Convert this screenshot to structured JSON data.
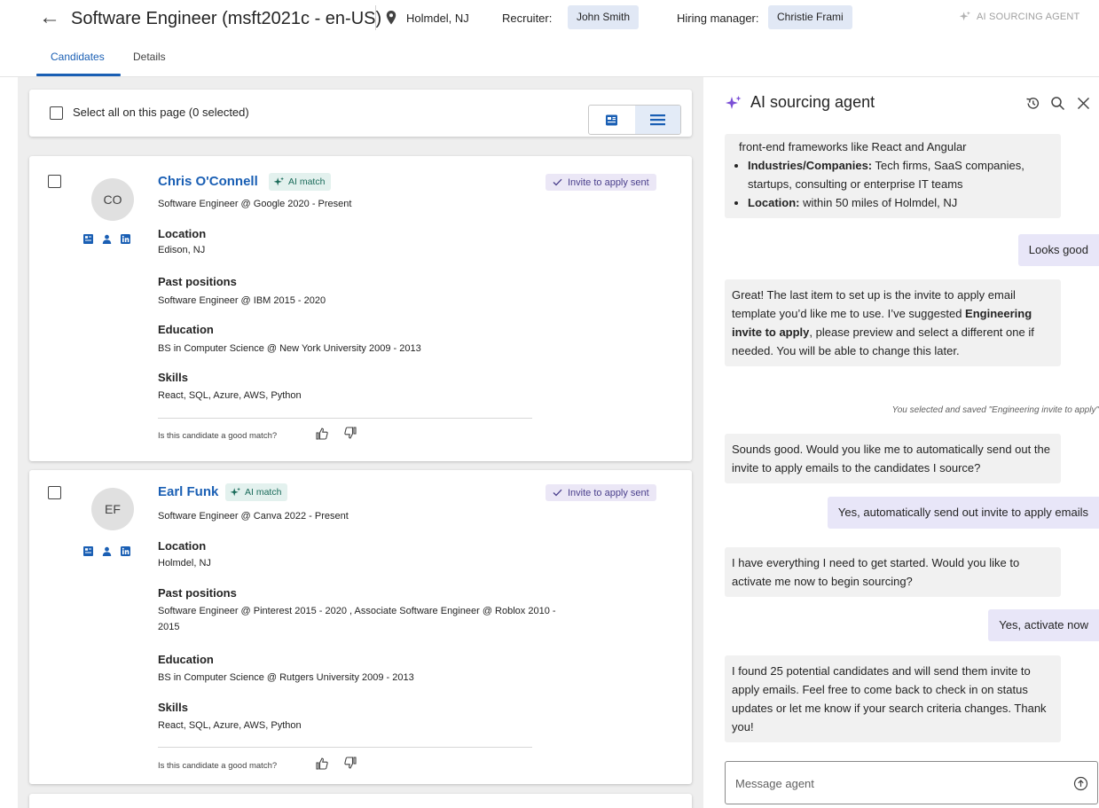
{
  "header": {
    "job_title": "Software Engineer (msft2021c - en-US)",
    "location": "Holmdel, NJ",
    "recruiter_label": "Recruiter:",
    "recruiter_name": "John Smith",
    "hiring_manager_label": "Hiring manager:",
    "hiring_manager_name": "Christie Frami",
    "sourcing_button": "AI SOURCING AGENT"
  },
  "tabs": [
    {
      "label": "Candidates",
      "active": true
    },
    {
      "label": "Details",
      "active": false
    }
  ],
  "select_all_label": "Select all on this page (0 selected)",
  "candidates": [
    {
      "initials": "CO",
      "name": "Chris O'Connell",
      "ai_badge": "AI match",
      "status": "Invite to apply sent",
      "headline": "Software Engineer @ Google 2020 - Present",
      "location_title": "Location",
      "location": "Edison, NJ",
      "past_title": "Past positions",
      "past": "Software Engineer @ IBM 2015 - 2020",
      "education_title": "Education",
      "education": "BS in Computer Science @ New York University 2009 - 2013",
      "skills_title": "Skills",
      "skills": "React, SQL, Azure, AWS, Python",
      "feedback_question": "Is this candidate a good match?"
    },
    {
      "initials": "EF",
      "name": "Earl Funk",
      "ai_badge": "AI match",
      "status": "Invite to apply sent",
      "headline": "Software Engineer @ Canva 2022 - Present",
      "location_title": "Location",
      "location": "Holmdel, NJ",
      "past_title": "Past positions",
      "past": "Software Engineer @ Pinterest 2015 - 2020 , Associate Software Engineer @ Roblox 2010 - 2015",
      "education_title": "Education",
      "education": "BS in Computer Science @ Rutgers University 2009 - 2013",
      "skills_title": "Skills",
      "skills": "React, SQL, Azure, AWS, Python",
      "feedback_question": "Is this candidate a good match?"
    }
  ],
  "agent": {
    "title": "AI sourcing agent",
    "msg1_intro": "front-end frameworks like React and Angular",
    "msg1_b1_label": "Industries/Companies:",
    "msg1_b1_text": " Tech firms, SaaS companies, startups, consulting or enterprise IT teams",
    "msg1_b2_label": "Location:",
    "msg1_b2_text": " within 50 miles of Holmdel, NJ",
    "user1": "Looks good",
    "msg2_a": "Great! The last item to set up is the invite to apply email template you’d like me to use.  I’ve suggested ",
    "msg2_bold": "Engineering invite to apply",
    "msg2_b": ", please preview and select a different one if needed. You will be able to change this later.",
    "note": "You selected and saved \"Engineering invite to apply\"",
    "msg3": "Sounds good. Would you like me to automatically send out the invite to apply emails to the candidates I source?",
    "user2": "Yes, automatically send out invite to apply emails",
    "msg4": "I have everything I need to get started. Would you like to activate me now to begin sourcing?",
    "user3": "Yes, activate now",
    "msg5": "I found 25 potential candidates and will send them invite to apply emails. Feel free to come back to check in on status updates or let me know if your search criteria changes. Thank you!",
    "input_placeholder": "Message agent",
    "input_value": ""
  },
  "colors": {
    "accent": "#1a5fb4",
    "ai_badge_bg": "#e3f1ee",
    "invite_badge_bg": "#ebe7f6",
    "user_bubble_bg": "#e8e6f8",
    "sparkle": "#7b4fd6"
  },
  "icons": [
    "back-arrow-icon",
    "location-pin-icon",
    "sparkle-icon",
    "resume-icon",
    "person-icon",
    "linkedin-icon",
    "checkmark-icon",
    "thumbs-up-icon",
    "thumbs-down-icon",
    "history-icon",
    "search-icon",
    "close-icon",
    "send-icon",
    "card-view-icon",
    "list-view-icon"
  ]
}
